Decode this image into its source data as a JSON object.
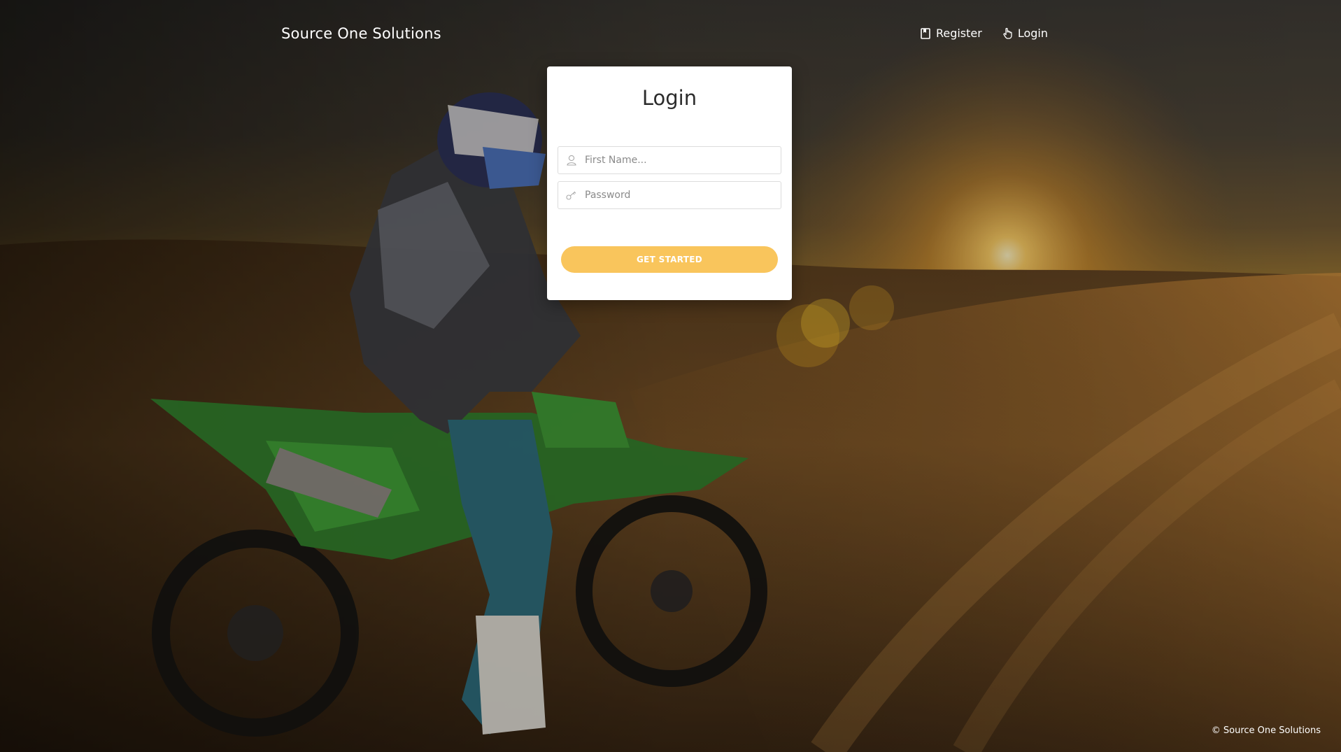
{
  "header": {
    "brand": "Source One Solutions",
    "nav": [
      {
        "label": "Register",
        "icon": "book-icon"
      },
      {
        "label": "Login",
        "icon": "pointer-hand-icon"
      }
    ]
  },
  "login_card": {
    "title": "Login",
    "first_name": {
      "placeholder": "First Name...",
      "value": "",
      "icon": "user-icon"
    },
    "password": {
      "placeholder": "Password",
      "value": "",
      "icon": "key-icon"
    },
    "submit_label": "GET STARTED"
  },
  "footer": {
    "copyright": "© Source One Solutions"
  },
  "colors": {
    "accent": "#f9c55c",
    "card_bg": "#ffffff",
    "text_light": "#ffffff"
  }
}
